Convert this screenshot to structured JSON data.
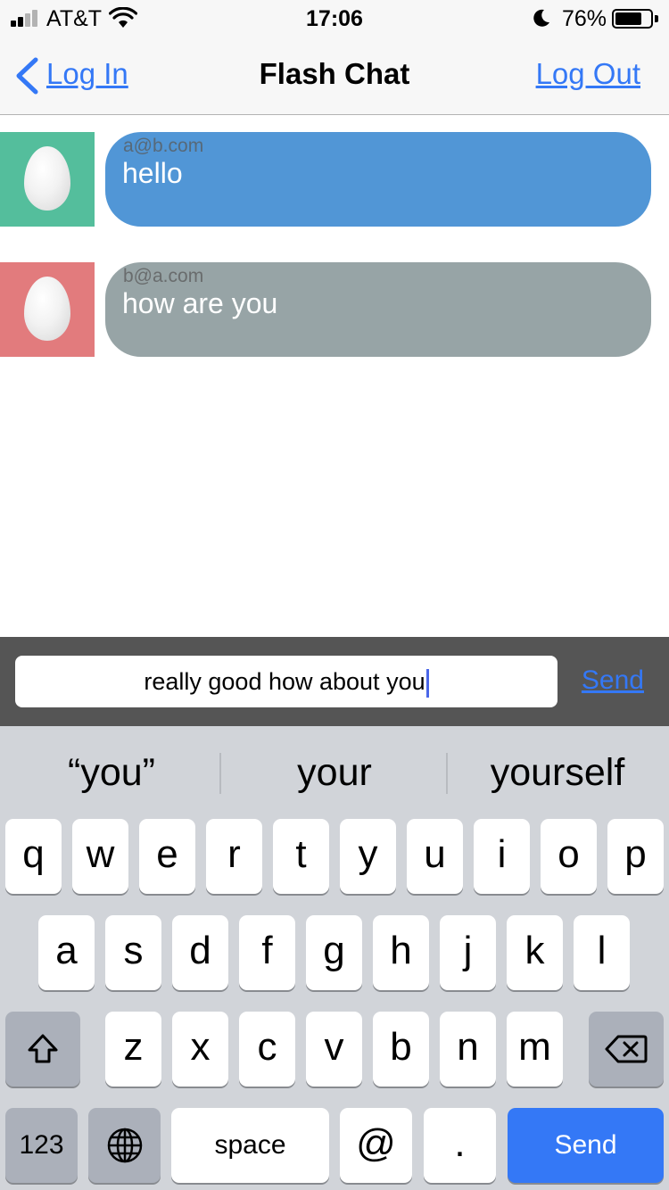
{
  "status_bar": {
    "carrier": "AT&T",
    "time": "17:06",
    "battery_percent": "76%",
    "battery_level": 0.76,
    "icons": [
      "signal-icon",
      "wifi-icon",
      "moon-icon",
      "battery-icon"
    ]
  },
  "nav": {
    "back_label": "Log In",
    "title": "Flash Chat",
    "right_label": "Log Out"
  },
  "messages": [
    {
      "sender": "a@b.com",
      "body": "hello",
      "bubble_color": "#5196d6",
      "avatar_color": "#54be9c"
    },
    {
      "sender": "b@a.com",
      "body": "how are you",
      "bubble_color": "#97a4a6",
      "avatar_color": "#e27b7d"
    }
  ],
  "compose": {
    "value": "really good how about you",
    "send_label": "Send"
  },
  "keyboard": {
    "suggestions": [
      "“you”",
      "your",
      "yourself"
    ],
    "row1": [
      "q",
      "w",
      "e",
      "r",
      "t",
      "y",
      "u",
      "i",
      "o",
      "p"
    ],
    "row2": [
      "a",
      "s",
      "d",
      "f",
      "g",
      "h",
      "j",
      "k",
      "l"
    ],
    "row3": [
      "z",
      "x",
      "c",
      "v",
      "b",
      "n",
      "m"
    ],
    "numbers_label": "123",
    "space_label": "space",
    "at_label": "@",
    "period_label": ".",
    "send_label": "Send"
  },
  "colors": {
    "accent": "#3478f6",
    "compose_bar": "#555555",
    "keyboard_bg": "#d1d4d9"
  }
}
